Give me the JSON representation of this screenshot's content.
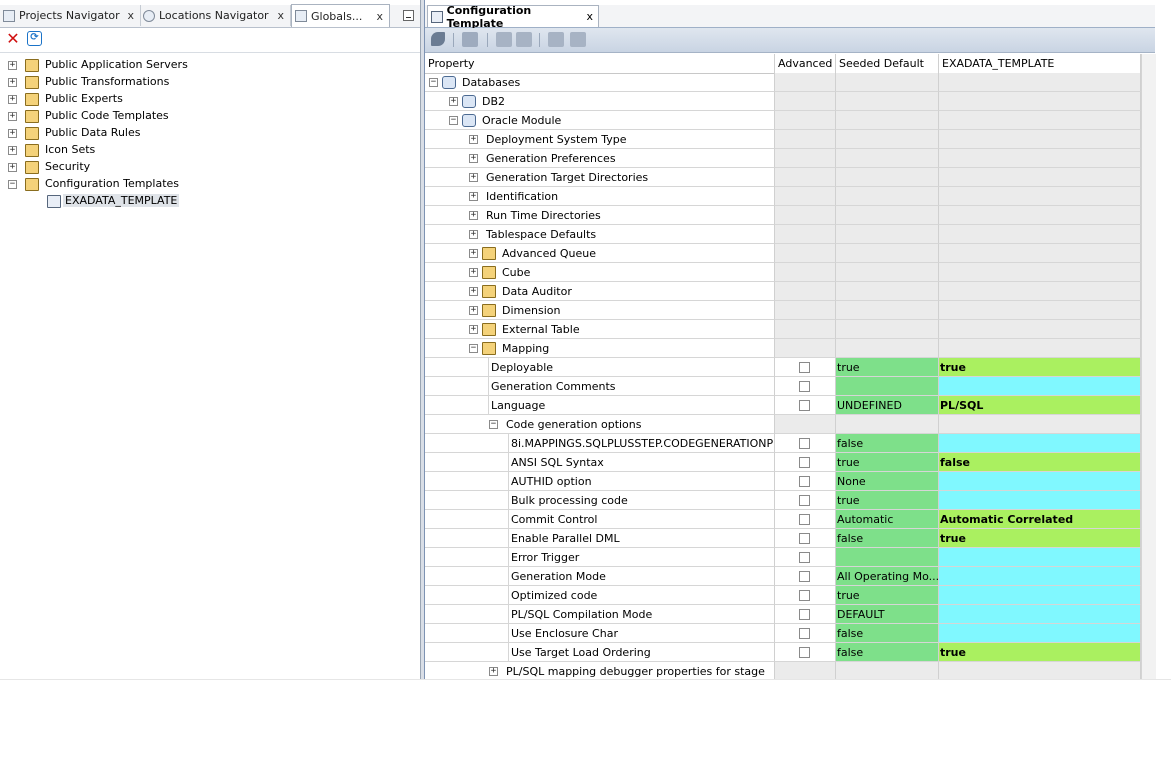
{
  "left_panel": {
    "tabs": [
      {
        "label": "Projects Navigator",
        "close": "x"
      },
      {
        "label": "Locations Navigator",
        "close": "x"
      },
      {
        "label": "Globals...",
        "close": "x"
      }
    ],
    "toolbar": {
      "delete_icon": "delete-icon",
      "refresh_icon": "refresh-icon"
    },
    "tree": [
      {
        "label": "Public Application Servers",
        "expander": "+"
      },
      {
        "label": "Public Transformations",
        "expander": "+"
      },
      {
        "label": "Public Experts",
        "expander": "+"
      },
      {
        "label": "Public Code Templates",
        "expander": "+"
      },
      {
        "label": "Public Data Rules",
        "expander": "+"
      },
      {
        "label": "Icon Sets",
        "expander": "+"
      },
      {
        "label": "Security",
        "expander": "+"
      },
      {
        "label": "Configuration Templates",
        "expander": "−"
      },
      {
        "label": "EXADATA_TEMPLATE",
        "expander": ""
      }
    ]
  },
  "editor": {
    "tab": {
      "label": "Configuration Template",
      "close": "x"
    },
    "columns": {
      "property": "Property",
      "advanced": "Advanced",
      "seeded_default": "Seeded Default",
      "template": "EXADATA_TEMPLATE"
    },
    "rows": [
      {
        "label": "Databases",
        "exp": "−",
        "icon": "cyl"
      },
      {
        "label": "DB2",
        "exp": "+",
        "icon": "cyl"
      },
      {
        "label": "Oracle Module",
        "exp": "−",
        "icon": "cyl"
      },
      {
        "label": "Deployment System Type",
        "exp": "+"
      },
      {
        "label": "Generation Preferences",
        "exp": "+"
      },
      {
        "label": "Generation Target Directories",
        "exp": "+"
      },
      {
        "label": "Identification",
        "exp": "+"
      },
      {
        "label": "Run Time Directories",
        "exp": "+"
      },
      {
        "label": "Tablespace Defaults",
        "exp": "+"
      },
      {
        "label": "Advanced Queue",
        "exp": "+",
        "icon": "folder"
      },
      {
        "label": "Cube",
        "exp": "+",
        "icon": "folder"
      },
      {
        "label": "Data Auditor",
        "exp": "+",
        "icon": "folder"
      },
      {
        "label": "Dimension",
        "exp": "+",
        "icon": "folder"
      },
      {
        "label": "External Table",
        "exp": "+",
        "icon": "folder"
      },
      {
        "label": "Mapping",
        "exp": "−",
        "icon": "folder"
      },
      {
        "label": "Deployable",
        "check": true,
        "seed": "true",
        "value": "true",
        "color": "lime"
      },
      {
        "label": "Generation Comments",
        "check": true,
        "seed": "",
        "value": "",
        "color": "cyan"
      },
      {
        "label": "Language",
        "check": true,
        "seed": "UNDEFINED",
        "value": "PL/SQL",
        "color": "lime"
      },
      {
        "label": "Code generation options",
        "exp": "−"
      },
      {
        "label": "8i.MAPPINGS.SQLPLUSSTEP.CODEGENERATIONP",
        "check": true,
        "seed": "false",
        "value": "",
        "color": "cyan"
      },
      {
        "label": "ANSI SQL Syntax",
        "check": true,
        "seed": "true",
        "value": "false",
        "color": "lime"
      },
      {
        "label": "AUTHID option",
        "check": true,
        "seed": "None",
        "value": "",
        "color": "cyan"
      },
      {
        "label": "Bulk processing code",
        "check": true,
        "seed": "true",
        "value": "",
        "color": "cyan"
      },
      {
        "label": "Commit Control",
        "check": true,
        "seed": "Automatic",
        "value": "Automatic Correlated",
        "color": "lime"
      },
      {
        "label": "Enable Parallel DML",
        "check": true,
        "seed": "false",
        "value": "true",
        "color": "lime"
      },
      {
        "label": "Error Trigger",
        "check": true,
        "seed": "",
        "value": "",
        "color": "cyan"
      },
      {
        "label": "Generation Mode",
        "check": true,
        "seed": "All Operating Mo...",
        "value": "",
        "color": "cyan"
      },
      {
        "label": "Optimized code",
        "check": true,
        "seed": "true",
        "value": "",
        "color": "cyan"
      },
      {
        "label": "PL/SQL Compilation Mode",
        "check": true,
        "seed": "DEFAULT",
        "value": "",
        "color": "cyan"
      },
      {
        "label": "Use Enclosure Char",
        "check": true,
        "seed": "false",
        "value": "",
        "color": "cyan"
      },
      {
        "label": "Use Target Load Ordering",
        "check": true,
        "seed": "false",
        "value": "true",
        "color": "lime"
      },
      {
        "label": "PL/SQL mapping debugger properties for stage",
        "exp": "+"
      }
    ]
  },
  "colors": {
    "seeded_green": "#7ee08a",
    "value_lime": "#aaf060",
    "value_cyan": "#80f8ff",
    "group_gray": "#ebebeb"
  }
}
